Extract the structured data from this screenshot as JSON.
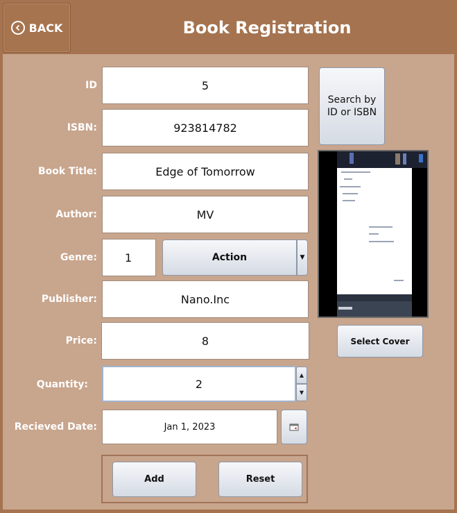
{
  "header": {
    "back_label": "BACK",
    "title": "Book Registration"
  },
  "form": {
    "id_label": "ID",
    "id_value": "5",
    "isbn_label": "ISBN:",
    "isbn_value": "923814782",
    "title_label": "Book Title:",
    "title_value": "Edge of Tomorrow",
    "author_label": "Author:",
    "author_value": "MV",
    "genre_label": "Genre:",
    "genre_id": "1",
    "genre_selected": "Action",
    "publisher_label": "Publisher:",
    "publisher_value": "Nano.Inc",
    "price_label": "Price:",
    "price_value": "8",
    "quantity_label": "Quantity:",
    "quantity_value": "2",
    "date_label": "Recieved Date:",
    "date_value": "Jan 1, 2023"
  },
  "buttons": {
    "search_label": "Search by\nID or ISBN",
    "select_cover_label": "Select Cover",
    "add_label": "Add",
    "reset_label": "Reset"
  }
}
